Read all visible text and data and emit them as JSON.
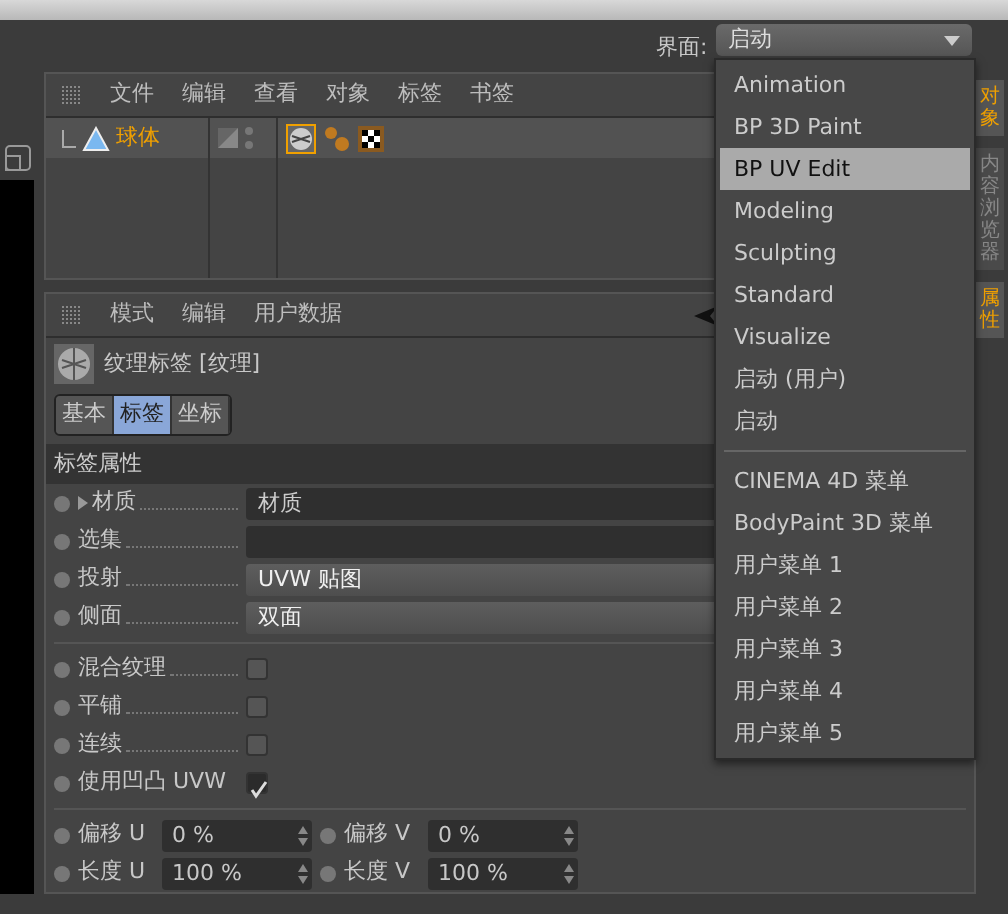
{
  "layout_switcher": {
    "label": "界面:",
    "value": "启动"
  },
  "layout_menu": {
    "groups": [
      [
        {
          "label": "Animation",
          "selected": false
        },
        {
          "label": "BP 3D Paint",
          "selected": false
        },
        {
          "label": "BP UV Edit",
          "selected": true
        },
        {
          "label": "Modeling",
          "selected": false
        },
        {
          "label": "Sculpting",
          "selected": false
        },
        {
          "label": "Standard",
          "selected": false
        },
        {
          "label": "Visualize",
          "selected": false
        },
        {
          "label": "启动 (用户)",
          "selected": false
        },
        {
          "label": "启动",
          "selected": false
        }
      ],
      [
        {
          "label": "CINEMA 4D 菜单",
          "selected": false
        },
        {
          "label": "BodyPaint 3D 菜单",
          "selected": false
        },
        {
          "label": "用户菜单 1",
          "selected": false
        },
        {
          "label": "用户菜单 2",
          "selected": false
        },
        {
          "label": "用户菜单 3",
          "selected": false
        },
        {
          "label": "用户菜单 4",
          "selected": false
        },
        {
          "label": "用户菜单 5",
          "selected": false
        }
      ]
    ]
  },
  "object_manager": {
    "menu": [
      "文件",
      "编辑",
      "查看",
      "对象",
      "标签",
      "书签"
    ],
    "object": {
      "name": "球体"
    }
  },
  "attribute_manager": {
    "menu": [
      "模式",
      "编辑",
      "用户数据"
    ],
    "title": "纹理标签 [纹理]",
    "tabs": [
      {
        "label": "基本",
        "selected": false
      },
      {
        "label": "标签",
        "selected": true
      },
      {
        "label": "坐标",
        "selected": false
      }
    ],
    "section": "标签属性",
    "fields": [
      {
        "kind": "link",
        "label": "材质",
        "value": "材质"
      },
      {
        "kind": "text",
        "label": "选集"
      },
      {
        "kind": "select",
        "label": "投射",
        "value": "UVW 贴图"
      },
      {
        "kind": "select",
        "label": "侧面",
        "value": "双面"
      }
    ],
    "checkboxes": [
      {
        "label": "混合纹理",
        "checked": false
      },
      {
        "label": "平铺",
        "checked": false
      },
      {
        "label": "连续",
        "checked": false
      },
      {
        "label": "使用凹凸 UVW",
        "checked": true
      }
    ],
    "number_rows": [
      [
        {
          "label": "偏移 U",
          "value": "0 %"
        },
        {
          "label": "偏移 V",
          "value": "0 %"
        }
      ],
      [
        {
          "label": "长度 U",
          "value": "100 %"
        },
        {
          "label": "长度 V",
          "value": "100 %"
        }
      ]
    ]
  },
  "side_tabs": [
    {
      "label": "对象",
      "active": true
    },
    {
      "label": "内容浏览器",
      "active": false
    },
    {
      "label": "属性",
      "active": true
    }
  ]
}
